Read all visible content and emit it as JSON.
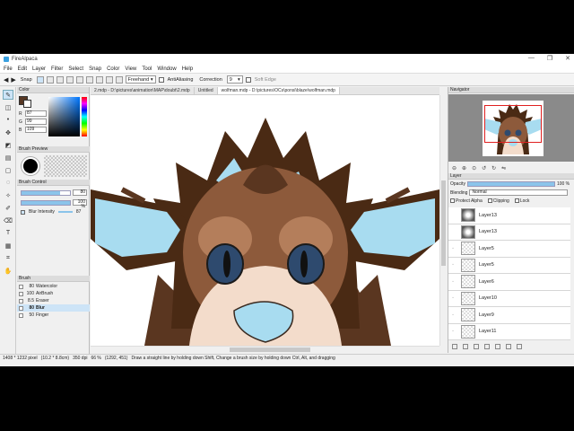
{
  "window": {
    "title": "FireAlpaca",
    "controls": [
      "—",
      "❐",
      "✕"
    ]
  },
  "menu": [
    "File",
    "Edit",
    "Layer",
    "Filter",
    "Select",
    "Snap",
    "Color",
    "View",
    "Tool",
    "Window",
    "Help"
  ],
  "toolbar": {
    "snap_label": "Snap",
    "snap_mode": "Freehand",
    "antialiasing_label": "AntiAliasing",
    "correction_label": "Correction",
    "correction_value": "9",
    "soft_edge_label": "Soft Edge"
  },
  "color_panel": {
    "title": "Color",
    "r": "87",
    "g": "99",
    "b": "109",
    "main_color": "#573723"
  },
  "brush_preview_panel": {
    "title": "Brush Preview"
  },
  "brush_control": {
    "title": "Brush Control",
    "size": "80",
    "opacity": "100 %",
    "blur_label": "Blur Intensity",
    "blur_value": "87",
    "size_fraction": 0.8,
    "opacity_fraction": 1.0
  },
  "brush_panel": {
    "title": "Brush",
    "items": [
      {
        "size": "80",
        "name": "Watercolor"
      },
      {
        "size": "100",
        "name": "AirBrush"
      },
      {
        "size": "8.5",
        "name": "Eraser"
      },
      {
        "size": "80",
        "name": "Blur"
      },
      {
        "size": "50",
        "name": "Finger"
      }
    ],
    "selected": "Blur"
  },
  "tabs": [
    {
      "label": "2.mdp - D:\\pictures\\animation\\MAP\\doubt\\2.mdp",
      "active": false
    },
    {
      "label": "Untitled",
      "active": false
    },
    {
      "label": "wolfman.mdp - D:\\pictures\\OCs\\ponsi\\blaze\\wolfman.mdp",
      "active": true
    }
  ],
  "navigator": {
    "title": "Navigator"
  },
  "layer_panel": {
    "title": "Layer",
    "opacity_label": "Opacity",
    "opacity_value": "100 %",
    "blending_label": "Blending",
    "blending_value": "Normal",
    "protect_alpha": "Protect Alpha",
    "clipping": "Clipping",
    "lock": "Lock",
    "layers": [
      {
        "name": "Layer13",
        "type": "folder"
      },
      {
        "name": "Layer13",
        "type": "folder"
      },
      {
        "name": "Layer5",
        "type": "layer"
      },
      {
        "name": "Layer5",
        "type": "layer"
      },
      {
        "name": "Layer6",
        "type": "layer"
      },
      {
        "name": "Layer10",
        "type": "layer"
      },
      {
        "name": "Layer9",
        "type": "layer"
      },
      {
        "name": "Layer11",
        "type": "layer"
      }
    ]
  },
  "status": {
    "canvas_size": "1408 * 1232 pixel",
    "physical_size": "(10.2 * 8.8cm)",
    "dpi": "350 dpi",
    "zoom": "66 %",
    "cursor": "(1292, 451)",
    "hint": "Draw a straight line by holding down Shift, Change a brush size by holding down Ctrl, Alt, and dragging"
  },
  "colors": {
    "fur_dark": "#4a2a14",
    "fur_mid": "#8d5a3b",
    "fur_light": "#b47e5b",
    "cream": "#f3dccb",
    "ear_blue": "#a8dcf0",
    "eye_blue": "#2e4a6e",
    "accent": "#8bc4ea"
  }
}
